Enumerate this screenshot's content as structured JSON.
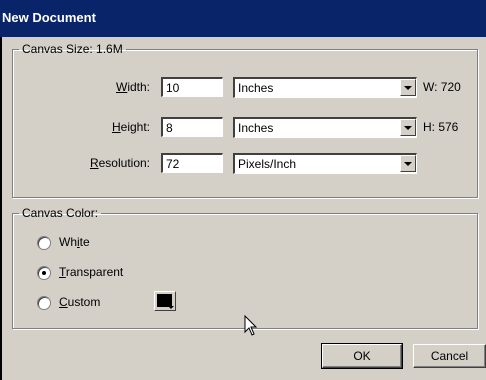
{
  "window": {
    "title": "New Document"
  },
  "canvas_size": {
    "legend": "Canvas Size: 1.6M",
    "width": {
      "label_pre": "",
      "label_key": "W",
      "label_post": "idth:",
      "value": "10",
      "unit": "Inches",
      "readout": "W: 720"
    },
    "height": {
      "label_pre": "",
      "label_key": "H",
      "label_post": "eight:",
      "value": "8",
      "unit": "Inches",
      "readout": "H: 576"
    },
    "resolution": {
      "label_pre": "",
      "label_key": "R",
      "label_post": "esolution:",
      "value": "72",
      "unit": "Pixels/Inch"
    }
  },
  "canvas_color": {
    "legend": "Canvas Color:",
    "options": [
      {
        "pre": "Wh",
        "key": "i",
        "post": "te",
        "selected": false
      },
      {
        "pre": "",
        "key": "T",
        "post": "ransparent",
        "selected": true
      },
      {
        "pre": "",
        "key": "C",
        "post": "ustom",
        "selected": false
      }
    ],
    "custom_color": "#000000"
  },
  "buttons": {
    "ok": "OK",
    "cancel": "Cancel"
  }
}
